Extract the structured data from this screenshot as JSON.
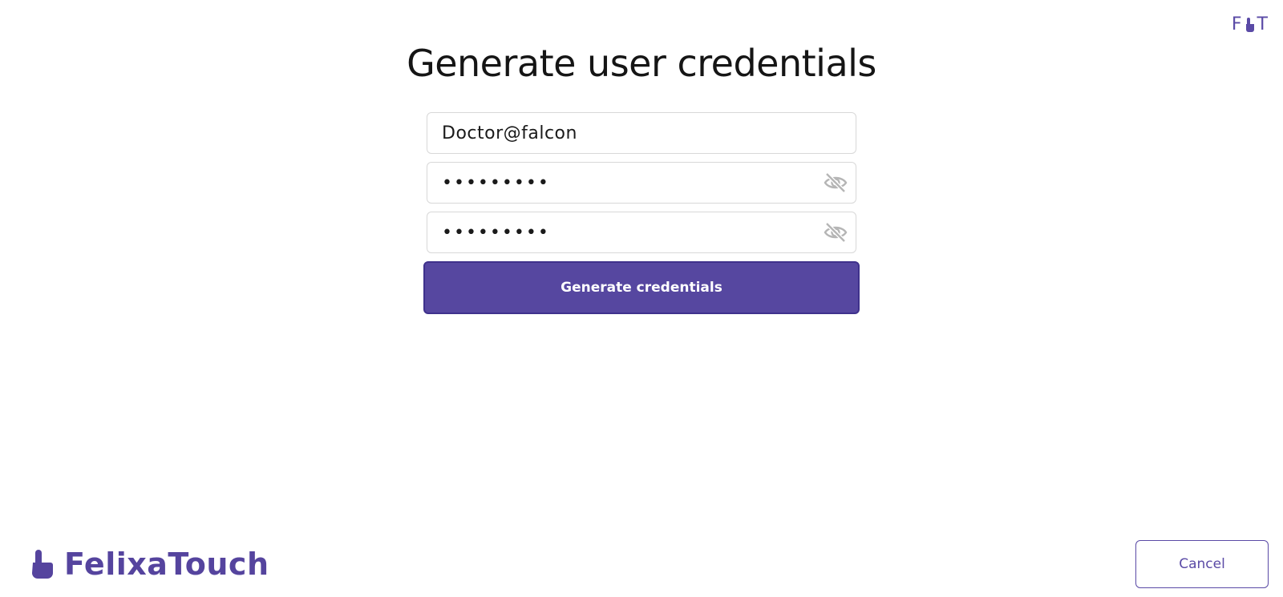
{
  "corner_logo": {
    "left_letter": "F",
    "right_letter": "T",
    "color": "#5a4aa6"
  },
  "title": "Generate user credentials",
  "form": {
    "username_value": "Doctor@falcon",
    "password_value": "•••••••••",
    "confirm_password_value": "•••••••••",
    "password_icon": "eye-off-icon",
    "confirm_password_icon": "eye-off-icon",
    "submit_label": "Generate credentials"
  },
  "footer": {
    "brand_name": "FelixaTouch",
    "brand_icon": "hand-pointer-icon",
    "cancel_label": "Cancel"
  },
  "colors": {
    "accent": "#5647a0",
    "brand": "#55449e",
    "border": "#d8d8d8",
    "icon_gray": "#b5b5b5"
  }
}
